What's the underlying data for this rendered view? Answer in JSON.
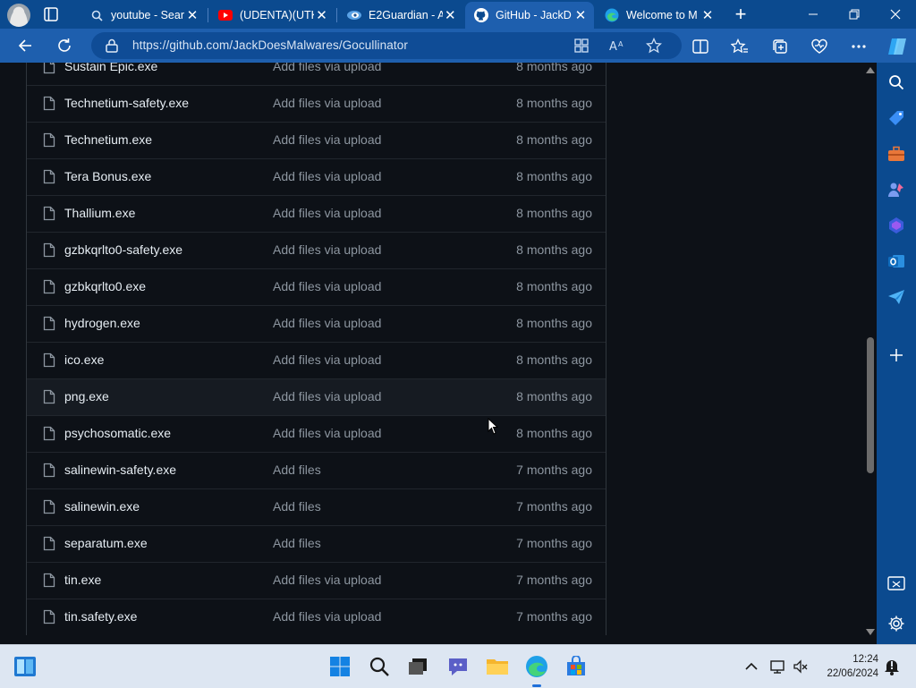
{
  "browser": {
    "tabs": [
      {
        "title": "youtube - Sear",
        "favicon": "search-icon",
        "active": false
      },
      {
        "title": "(UDENTA)(UTK",
        "favicon": "youtube-icon",
        "active": false
      },
      {
        "title": "E2Guardian - A",
        "favicon": "e2guardian-icon",
        "active": false
      },
      {
        "title": "GitHub - JackD",
        "favicon": "github-icon",
        "active": true
      },
      {
        "title": "Welcome to M",
        "favicon": "edge-icon",
        "active": false
      }
    ],
    "close_glyph": "✕",
    "new_tab_glyph": "+",
    "url": "https://github.com/JackDoesMalwares/Gocullinator",
    "accent_color": "#1e5fae",
    "tabstrip_color": "#0b4a8f"
  },
  "files": [
    {
      "name": "Sustain Epic.exe",
      "message": "Add files via upload",
      "date": "8 months ago"
    },
    {
      "name": "Technetium-safety.exe",
      "message": "Add files via upload",
      "date": "8 months ago"
    },
    {
      "name": "Technetium.exe",
      "message": "Add files via upload",
      "date": "8 months ago"
    },
    {
      "name": "Tera Bonus.exe",
      "message": "Add files via upload",
      "date": "8 months ago"
    },
    {
      "name": "Thallium.exe",
      "message": "Add files via upload",
      "date": "8 months ago"
    },
    {
      "name": "gzbkqrlto0-safety.exe",
      "message": "Add files via upload",
      "date": "8 months ago"
    },
    {
      "name": "gzbkqrlto0.exe",
      "message": "Add files via upload",
      "date": "8 months ago"
    },
    {
      "name": "hydrogen.exe",
      "message": "Add files via upload",
      "date": "8 months ago"
    },
    {
      "name": "ico.exe",
      "message": "Add files via upload",
      "date": "8 months ago"
    },
    {
      "name": "png.exe",
      "message": "Add files via upload",
      "date": "8 months ago",
      "hover": true
    },
    {
      "name": "psychosomatic.exe",
      "message": "Add files via upload",
      "date": "8 months ago"
    },
    {
      "name": "salinewin-safety.exe",
      "message": "Add files",
      "date": "7 months ago"
    },
    {
      "name": "salinewin.exe",
      "message": "Add files",
      "date": "7 months ago"
    },
    {
      "name": "separatum.exe",
      "message": "Add files",
      "date": "7 months ago"
    },
    {
      "name": "tin.exe",
      "message": "Add files via upload",
      "date": "7 months ago"
    },
    {
      "name": "tin.safety.exe",
      "message": "Add files via upload",
      "date": "7 months ago"
    }
  ],
  "taskbar": {
    "time": "12:24",
    "date": "22/06/2024"
  }
}
